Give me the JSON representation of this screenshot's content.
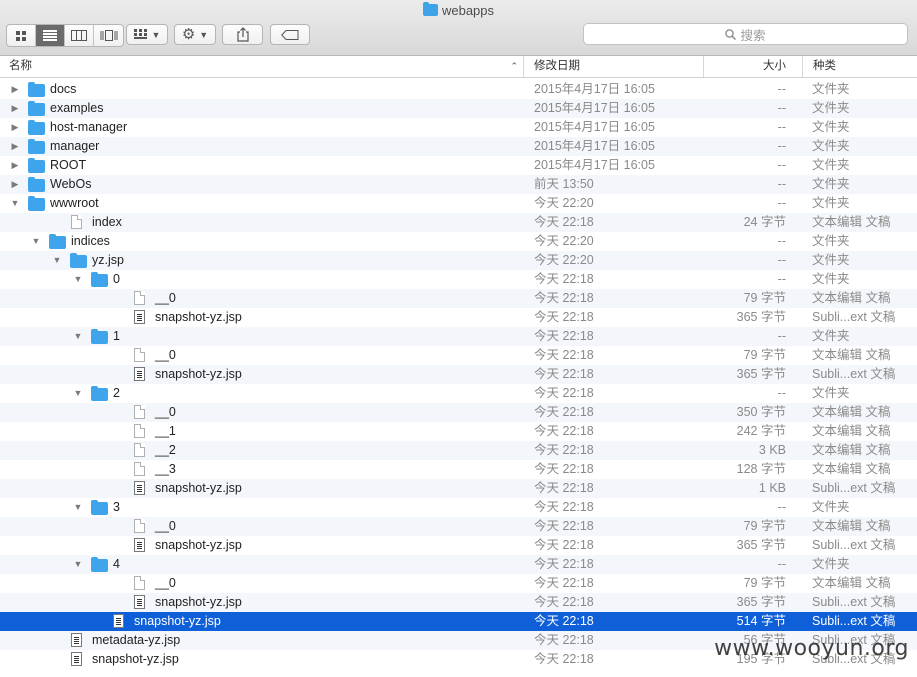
{
  "window": {
    "title": "webapps"
  },
  "toolbar": {
    "view_icons": [
      "icon-view-icon",
      "list-view-icon",
      "column-view-icon",
      "coverflow-view-icon"
    ],
    "search_placeholder": "搜索"
  },
  "columns": {
    "name": "名称",
    "date": "修改日期",
    "size": "大小",
    "kind": "种类"
  },
  "rows": [
    {
      "depth": 0,
      "toggle": "closed",
      "icon": "folder",
      "name": "docs",
      "date": "2015年4月17日 16:05",
      "size": "--",
      "kind": "文件夹"
    },
    {
      "depth": 0,
      "toggle": "closed",
      "icon": "folder",
      "name": "examples",
      "date": "2015年4月17日 16:05",
      "size": "--",
      "kind": "文件夹"
    },
    {
      "depth": 0,
      "toggle": "closed",
      "icon": "folder",
      "name": "host-manager",
      "date": "2015年4月17日 16:05",
      "size": "--",
      "kind": "文件夹"
    },
    {
      "depth": 0,
      "toggle": "closed",
      "icon": "folder",
      "name": "manager",
      "date": "2015年4月17日 16:05",
      "size": "--",
      "kind": "文件夹"
    },
    {
      "depth": 0,
      "toggle": "closed",
      "icon": "folder",
      "name": "ROOT",
      "date": "2015年4月17日 16:05",
      "size": "--",
      "kind": "文件夹"
    },
    {
      "depth": 0,
      "toggle": "closed",
      "icon": "folder",
      "name": "WebOs",
      "date": "前天 13:50",
      "size": "--",
      "kind": "文件夹"
    },
    {
      "depth": 0,
      "toggle": "open",
      "icon": "folder",
      "name": "wwwroot",
      "date": "今天 22:20",
      "size": "--",
      "kind": "文件夹"
    },
    {
      "depth": 1,
      "toggle": "none",
      "icon": "doc",
      "name": "index",
      "date": "今天 22:18",
      "size": "24 字节",
      "kind": "文本编辑 文稿"
    },
    {
      "depth": 1,
      "toggle": "open",
      "icon": "folder",
      "name": "indices",
      "date": "今天 22:20",
      "size": "--",
      "kind": "文件夹"
    },
    {
      "depth": 2,
      "toggle": "open",
      "icon": "folder",
      "name": "yz.jsp",
      "date": "今天 22:20",
      "size": "--",
      "kind": "文件夹"
    },
    {
      "depth": 3,
      "toggle": "open",
      "icon": "folder",
      "name": "0",
      "date": "今天 22:18",
      "size": "--",
      "kind": "文件夹"
    },
    {
      "depth": 4,
      "toggle": "none",
      "icon": "doc",
      "name": "__0",
      "date": "今天 22:18",
      "size": "79 字节",
      "kind": "文本编辑 文稿"
    },
    {
      "depth": 4,
      "toggle": "none",
      "icon": "jsp",
      "name": "snapshot-yz.jsp",
      "date": "今天 22:18",
      "size": "365 字节",
      "kind": "Subli...ext 文稿"
    },
    {
      "depth": 3,
      "toggle": "open",
      "icon": "folder",
      "name": "1",
      "date": "今天 22:18",
      "size": "--",
      "kind": "文件夹"
    },
    {
      "depth": 4,
      "toggle": "none",
      "icon": "doc",
      "name": "__0",
      "date": "今天 22:18",
      "size": "79 字节",
      "kind": "文本编辑 文稿"
    },
    {
      "depth": 4,
      "toggle": "none",
      "icon": "jsp",
      "name": "snapshot-yz.jsp",
      "date": "今天 22:18",
      "size": "365 字节",
      "kind": "Subli...ext 文稿"
    },
    {
      "depth": 3,
      "toggle": "open",
      "icon": "folder",
      "name": "2",
      "date": "今天 22:18",
      "size": "--",
      "kind": "文件夹"
    },
    {
      "depth": 4,
      "toggle": "none",
      "icon": "doc",
      "name": "__0",
      "date": "今天 22:18",
      "size": "350 字节",
      "kind": "文本编辑 文稿"
    },
    {
      "depth": 4,
      "toggle": "none",
      "icon": "doc",
      "name": "__1",
      "date": "今天 22:18",
      "size": "242 字节",
      "kind": "文本编辑 文稿"
    },
    {
      "depth": 4,
      "toggle": "none",
      "icon": "doc",
      "name": "__2",
      "date": "今天 22:18",
      "size": "3 KB",
      "kind": "文本编辑 文稿"
    },
    {
      "depth": 4,
      "toggle": "none",
      "icon": "doc",
      "name": "__3",
      "date": "今天 22:18",
      "size": "128 字节",
      "kind": "文本编辑 文稿"
    },
    {
      "depth": 4,
      "toggle": "none",
      "icon": "jsp",
      "name": "snapshot-yz.jsp",
      "date": "今天 22:18",
      "size": "1 KB",
      "kind": "Subli...ext 文稿"
    },
    {
      "depth": 3,
      "toggle": "open",
      "icon": "folder",
      "name": "3",
      "date": "今天 22:18",
      "size": "--",
      "kind": "文件夹"
    },
    {
      "depth": 4,
      "toggle": "none",
      "icon": "doc",
      "name": "__0",
      "date": "今天 22:18",
      "size": "79 字节",
      "kind": "文本编辑 文稿"
    },
    {
      "depth": 4,
      "toggle": "none",
      "icon": "jsp",
      "name": "snapshot-yz.jsp",
      "date": "今天 22:18",
      "size": "365 字节",
      "kind": "Subli...ext 文稿"
    },
    {
      "depth": 3,
      "toggle": "open",
      "icon": "folder",
      "name": "4",
      "date": "今天 22:18",
      "size": "--",
      "kind": "文件夹"
    },
    {
      "depth": 4,
      "toggle": "none",
      "icon": "doc",
      "name": "__0",
      "date": "今天 22:18",
      "size": "79 字节",
      "kind": "文本编辑 文稿"
    },
    {
      "depth": 4,
      "toggle": "none",
      "icon": "jsp",
      "name": "snapshot-yz.jsp",
      "date": "今天 22:18",
      "size": "365 字节",
      "kind": "Subli...ext 文稿"
    },
    {
      "depth": 3,
      "toggle": "none",
      "icon": "jsp",
      "name": "snapshot-yz.jsp",
      "date": "今天 22:18",
      "size": "514 字节",
      "kind": "Subli...ext 文稿",
      "selected": true
    },
    {
      "depth": 1,
      "toggle": "none",
      "icon": "jsp",
      "name": "metadata-yz.jsp",
      "date": "今天 22:18",
      "size": "56 字节",
      "kind": "Subli...ext 文稿"
    },
    {
      "depth": 1,
      "toggle": "none",
      "icon": "jsp",
      "name": "snapshot-yz.jsp",
      "date": "今天 22:18",
      "size": "195 字节",
      "kind": "Subli...ext 文稿"
    }
  ],
  "watermark": "www.wooyun.org"
}
